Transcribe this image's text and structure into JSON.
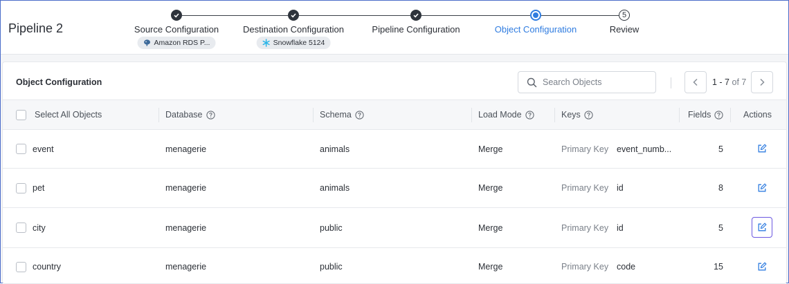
{
  "header": {
    "pipeline_title": "Pipeline 2",
    "steps": [
      {
        "label": "Source Configuration",
        "state": "done"
      },
      {
        "label": "Destination Configuration",
        "state": "done"
      },
      {
        "label": "Pipeline Configuration",
        "state": "done"
      },
      {
        "label": "Object Configuration",
        "state": "active"
      },
      {
        "label": "Review",
        "state": "pending",
        "number": "5"
      }
    ],
    "source_chip": "Amazon RDS P...",
    "destination_chip": "Snowflake 5124"
  },
  "card": {
    "title": "Object Configuration",
    "search_placeholder": "Search Objects",
    "pager": {
      "range": "1 - 7",
      "of_text": "of 7"
    }
  },
  "table": {
    "columns": {
      "select_all": "Select All Objects",
      "database": "Database",
      "schema": "Schema",
      "load_mode": "Load Mode",
      "keys": "Keys",
      "fields": "Fields",
      "actions": "Actions"
    },
    "rows": [
      {
        "name": "event",
        "database": "menagerie",
        "schema": "animals",
        "load_mode": "Merge",
        "key_type": "Primary Key",
        "key_value": "event_numb...",
        "fields": "5"
      },
      {
        "name": "pet",
        "database": "menagerie",
        "schema": "animals",
        "load_mode": "Merge",
        "key_type": "Primary Key",
        "key_value": "id",
        "fields": "8"
      },
      {
        "name": "city",
        "database": "menagerie",
        "schema": "public",
        "load_mode": "Merge",
        "key_type": "Primary Key",
        "key_value": "id",
        "fields": "5"
      },
      {
        "name": "country",
        "database": "menagerie",
        "schema": "public",
        "load_mode": "Merge",
        "key_type": "Primary Key",
        "key_value": "code",
        "fields": "15"
      }
    ]
  },
  "colors": {
    "accent": "#2f7ce0",
    "focus_ring": "#6b57e0",
    "step_done": "#2e343c"
  }
}
